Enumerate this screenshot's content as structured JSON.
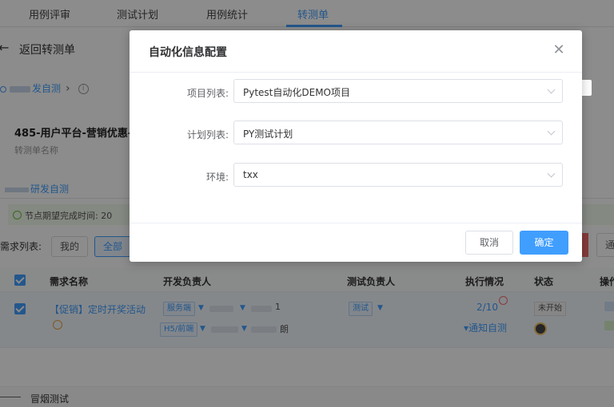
{
  "topnav": {
    "tabs": [
      {
        "label": "用例评审"
      },
      {
        "label": "测试计划"
      },
      {
        "label": "用例统计"
      },
      {
        "label": "转测单"
      }
    ]
  },
  "back": {
    "label": "返回转测单"
  },
  "breadcrumb": {
    "link": "发自测"
  },
  "request": {
    "title": "485-用户平台-营销优惠-",
    "subtitle": "转测单名称"
  },
  "stage": {
    "label": "研发自测"
  },
  "notice": {
    "text": "节点期望完成时间: 20"
  },
  "filter": {
    "label": "需求列表:",
    "mine": "我的",
    "all": "全部",
    "right_button": "通"
  },
  "table": {
    "headers": {
      "name": "需求名称",
      "dev_owner": "开发负责人",
      "test_owner": "测试负责人",
      "exec": "执行情况",
      "status": "状态",
      "op": "操作"
    },
    "row": {
      "name": "【促销】定时开奖活动",
      "dev_tag_1": "服务端",
      "dev_tag_2": "H5/前端",
      "dev_suffix_1": "1",
      "dev_suffix_2": "朗",
      "test_tag": "测试",
      "exec_count": "2/10",
      "exec_link": "▾通知自测",
      "status": "未开始"
    }
  },
  "footer": {
    "label": "冒烟测试"
  },
  "dialog": {
    "title": "自动化信息配置",
    "fields": [
      {
        "label": "项目列表:",
        "value": "Pytest自动化DEMO项目"
      },
      {
        "label": "计划列表:",
        "value": "PY测试计划"
      },
      {
        "label": "环境:",
        "value": "txx"
      }
    ],
    "cancel_label": "取消",
    "ok_label": "确定"
  },
  "colors": {
    "primary": "#409eff",
    "success": "#67c23a",
    "danger": "#f56c6c",
    "mask": "rgba(0,0,0,0.45)"
  },
  "icons": {
    "back": "arrow-left-icon",
    "close": "close-icon",
    "dropdown": "chevron-down-icon"
  }
}
